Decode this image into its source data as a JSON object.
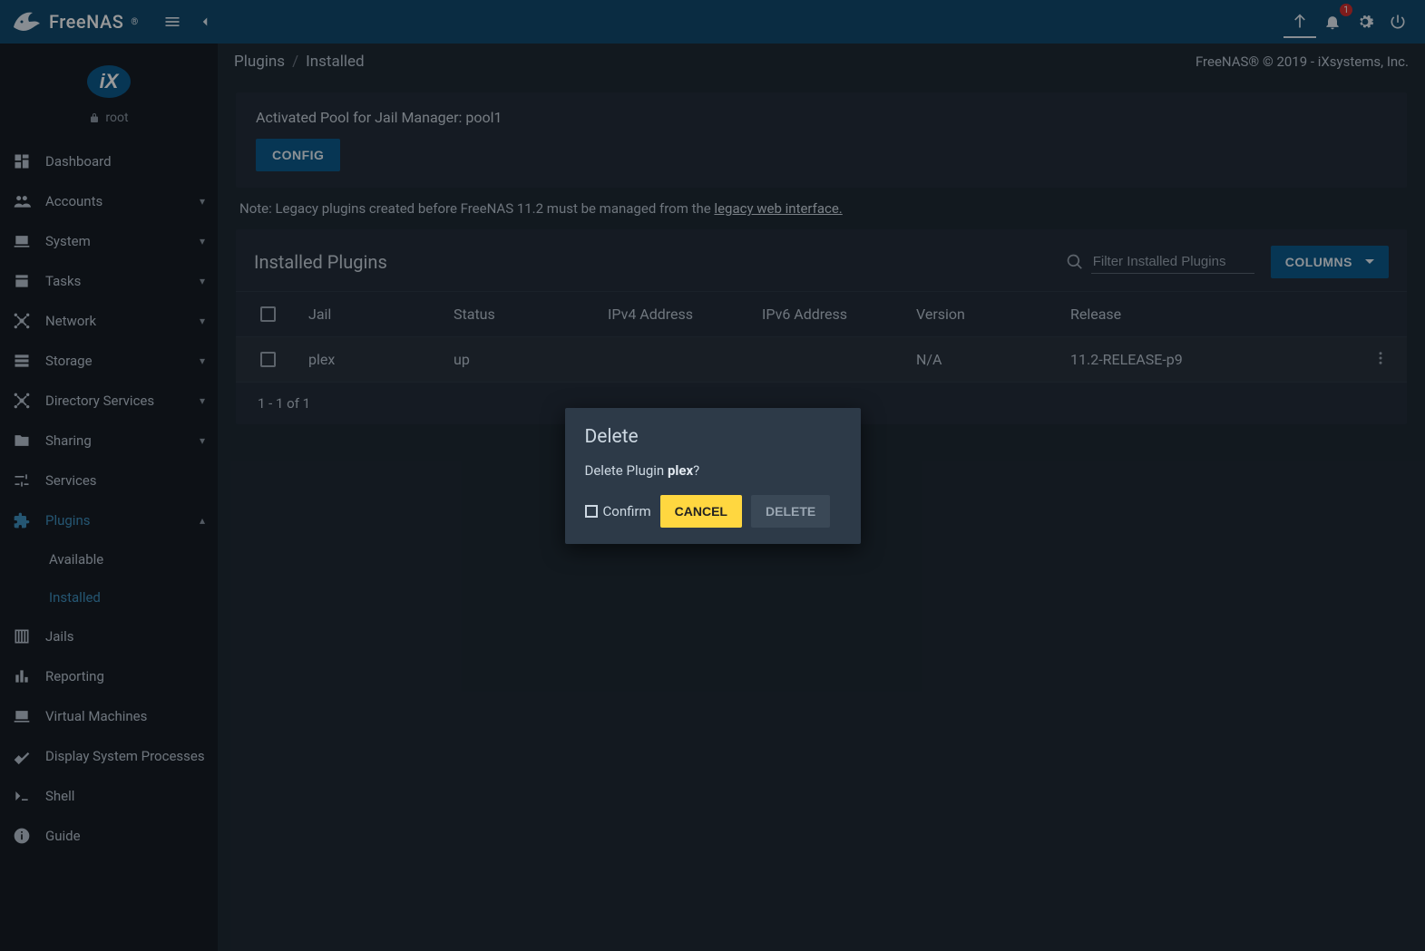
{
  "brand": "FreeNAS",
  "user": {
    "name": "root"
  },
  "notifications": {
    "count": "1"
  },
  "breadcrumb": {
    "section": "Plugins",
    "page": "Installed"
  },
  "copyright": "FreeNAS® © 2019 - iXsystems, Inc.",
  "pool_panel": {
    "text": "Activated Pool for Jail Manager: pool1",
    "config_btn": "CONFIG"
  },
  "note": {
    "prefix": "Note: Legacy plugins created before FreeNAS 11.2 must be managed from the ",
    "link": "legacy web interface."
  },
  "table": {
    "title": "Installed Plugins",
    "search_placeholder": "Filter Installed Plugins",
    "columns_btn": "COLUMNS",
    "headers": {
      "jail": "Jail",
      "status": "Status",
      "ip4": "IPv4 Address",
      "ip6": "IPv6 Address",
      "version": "Version",
      "release": "Release"
    },
    "rows": [
      {
        "jail": "plex",
        "status": "up",
        "ip4": "",
        "ip6": "",
        "version": "N/A",
        "release": "11.2-RELEASE-p9"
      }
    ],
    "footer": "1 - 1 of 1"
  },
  "sidebar": {
    "items": [
      {
        "label": "Dashboard",
        "icon": "dashboard",
        "expandable": false
      },
      {
        "label": "Accounts",
        "icon": "people",
        "expandable": true
      },
      {
        "label": "System",
        "icon": "laptop",
        "expandable": true
      },
      {
        "label": "Tasks",
        "icon": "calendar",
        "expandable": true
      },
      {
        "label": "Network",
        "icon": "hub",
        "expandable": true
      },
      {
        "label": "Storage",
        "icon": "storage",
        "expandable": true
      },
      {
        "label": "Directory Services",
        "icon": "hub",
        "expandable": true
      },
      {
        "label": "Sharing",
        "icon": "folder",
        "expandable": true
      },
      {
        "label": "Services",
        "icon": "tune",
        "expandable": false
      },
      {
        "label": "Plugins",
        "icon": "extension",
        "expandable": true,
        "active": true,
        "children": [
          {
            "label": "Available"
          },
          {
            "label": "Installed",
            "active": true
          }
        ]
      },
      {
        "label": "Jails",
        "icon": "jail",
        "expandable": false
      },
      {
        "label": "Reporting",
        "icon": "chart",
        "expandable": false
      },
      {
        "label": "Virtual Machines",
        "icon": "laptop",
        "expandable": false
      },
      {
        "label": "Display System Processes",
        "icon": "build",
        "expandable": false
      },
      {
        "label": "Shell",
        "icon": "terminal",
        "expandable": false
      },
      {
        "label": "Guide",
        "icon": "info",
        "expandable": false
      }
    ]
  },
  "dialog": {
    "title": "Delete",
    "msg_prefix": "Delete Plugin ",
    "msg_target": "plex",
    "msg_suffix": "?",
    "confirm_label": "Confirm",
    "cancel": "CANCEL",
    "delete": "DELETE"
  }
}
